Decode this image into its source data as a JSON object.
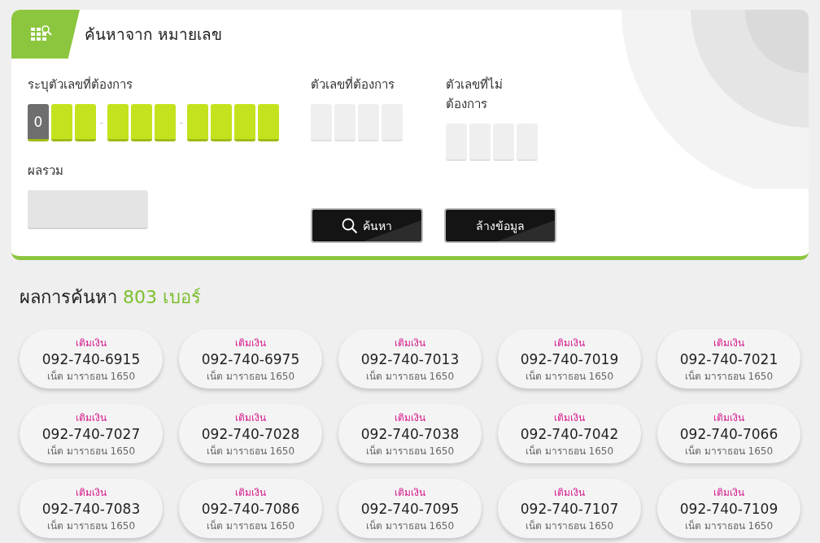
{
  "search_panel": {
    "title": "ค้นหาจาก หมายเลข",
    "wanted_number": {
      "label": "ระบุตัวเลขที่ต้องการ",
      "cells": [
        {
          "kind": "fixed",
          "value": "0"
        },
        {
          "kind": "input"
        },
        {
          "kind": "input"
        },
        {
          "kind": "separator",
          "value": "-"
        },
        {
          "kind": "input"
        },
        {
          "kind": "input"
        },
        {
          "kind": "input"
        },
        {
          "kind": "separator",
          "value": "-"
        },
        {
          "kind": "input"
        },
        {
          "kind": "input"
        },
        {
          "kind": "input"
        },
        {
          "kind": "input"
        }
      ]
    },
    "include_digits": {
      "label": "ตัวเลขที่ต้องการ",
      "cells": [
        {
          "kind": "input"
        },
        {
          "kind": "input"
        },
        {
          "kind": "input"
        },
        {
          "kind": "input"
        }
      ]
    },
    "exclude_digits": {
      "label": "ตัวเลขที่ไม่ต้องการ",
      "cells": [
        {
          "kind": "input"
        },
        {
          "kind": "input"
        },
        {
          "kind": "input"
        },
        {
          "kind": "input"
        }
      ]
    },
    "sum": {
      "label": "ผลรวม"
    },
    "buttons": [
      {
        "kind": "search",
        "label": "ค้นหา"
      },
      {
        "kind": "clear",
        "label": "ล้างข้อมูล"
      }
    ]
  },
  "results": {
    "title": "ผลการค้นหา",
    "count": "803 เบอร์",
    "items": [
      {
        "tag": "เติมเงิน",
        "number": "092-740-6915",
        "package": "เน็ต มาราธอน 1650"
      },
      {
        "tag": "เติมเงิน",
        "number": "092-740-6975",
        "package": "เน็ต มาราธอน 1650"
      },
      {
        "tag": "เติมเงิน",
        "number": "092-740-7013",
        "package": "เน็ต มาราธอน 1650"
      },
      {
        "tag": "เติมเงิน",
        "number": "092-740-7019",
        "package": "เน็ต มาราธอน 1650"
      },
      {
        "tag": "เติมเงิน",
        "number": "092-740-7021",
        "package": "เน็ต มาราธอน 1650"
      },
      {
        "tag": "เติมเงิน",
        "number": "092-740-7027",
        "package": "เน็ต มาราธอน 1650"
      },
      {
        "tag": "เติมเงิน",
        "number": "092-740-7028",
        "package": "เน็ต มาราธอน 1650"
      },
      {
        "tag": "เติมเงิน",
        "number": "092-740-7038",
        "package": "เน็ต มาราธอน 1650"
      },
      {
        "tag": "เติมเงิน",
        "number": "092-740-7042",
        "package": "เน็ต มาราธอน 1650"
      },
      {
        "tag": "เติมเงิน",
        "number": "092-740-7066",
        "package": "เน็ต มาราธอน 1650"
      },
      {
        "tag": "เติมเงิน",
        "number": "092-740-7083",
        "package": "เน็ต มาราธอน 1650"
      },
      {
        "tag": "เติมเงิน",
        "number": "092-740-7086",
        "package": "เน็ต มาราธอน 1650"
      },
      {
        "tag": "เติมเงิน",
        "number": "092-740-7095",
        "package": "เน็ต มาราธอน 1650"
      },
      {
        "tag": "เติมเงิน",
        "number": "092-740-7107",
        "package": "เน็ต มาราธอน 1650"
      },
      {
        "tag": "เติมเงิน",
        "number": "092-740-7109",
        "package": "เน็ต มาราธอน 1650"
      }
    ]
  }
}
